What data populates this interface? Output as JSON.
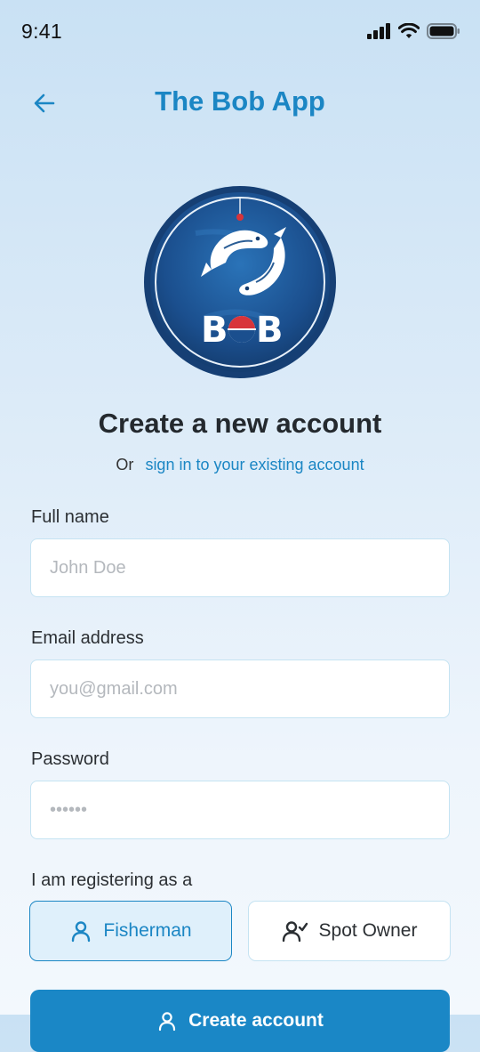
{
  "status_bar": {
    "time": "9:41"
  },
  "header": {
    "title": "The Bob App"
  },
  "logo": {
    "text": "BOB"
  },
  "main": {
    "heading": "Create a new account",
    "or_text": "Or",
    "signin_link": "sign in to your existing account"
  },
  "form": {
    "full_name": {
      "label": "Full name",
      "placeholder": "John Doe",
      "value": ""
    },
    "email": {
      "label": "Email address",
      "placeholder": "you@gmail.com",
      "value": ""
    },
    "password": {
      "label": "Password",
      "placeholder": "••••••",
      "value": ""
    },
    "role_label": "I am registering as a",
    "roles": [
      {
        "label": "Fisherman",
        "icon": "user-icon",
        "selected": true
      },
      {
        "label": "Spot Owner",
        "icon": "user-check-icon",
        "selected": false
      }
    ],
    "submit_label": "Create account"
  },
  "colors": {
    "accent": "#1b86c4",
    "border": "#c5e3f2",
    "selected_bg": "#dff0fb"
  }
}
